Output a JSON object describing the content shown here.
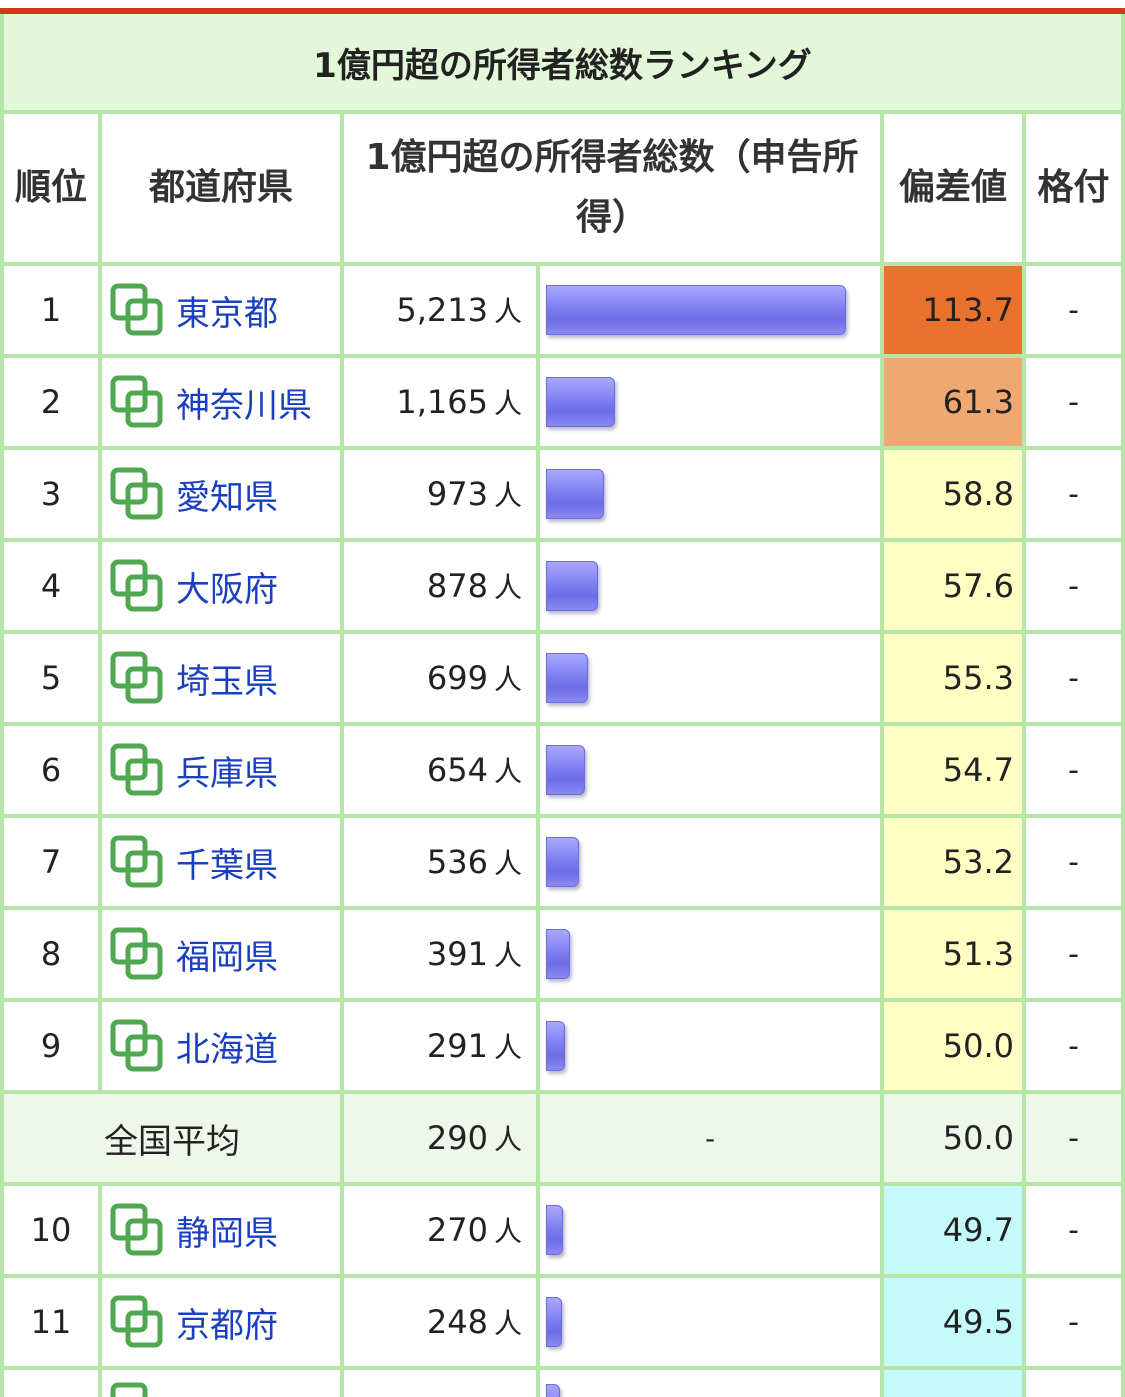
{
  "title": "1億円超の所得者総数ランキング",
  "headers": {
    "rank": "順位",
    "prefecture": "都道府県",
    "total": "1億円超の所得者総数（申告所得）",
    "deviation": "偏差値",
    "grade": "格付"
  },
  "unit": "人",
  "rows": [
    {
      "rank": "1",
      "name": "東京都",
      "value": "5,213",
      "count": 5213,
      "dev": "113.7",
      "grade": "-",
      "color": "#e8722e"
    },
    {
      "rank": "2",
      "name": "神奈川県",
      "value": "1,165",
      "count": 1165,
      "dev": "61.3",
      "grade": "-",
      "color": "#efa872"
    },
    {
      "rank": "3",
      "name": "愛知県",
      "value": "973",
      "count": 973,
      "dev": "58.8",
      "grade": "-",
      "color": "#ffffc4"
    },
    {
      "rank": "4",
      "name": "大阪府",
      "value": "878",
      "count": 878,
      "dev": "57.6",
      "grade": "-",
      "color": "#ffffc4"
    },
    {
      "rank": "5",
      "name": "埼玉県",
      "value": "699",
      "count": 699,
      "dev": "55.3",
      "grade": "-",
      "color": "#ffffc4"
    },
    {
      "rank": "6",
      "name": "兵庫県",
      "value": "654",
      "count": 654,
      "dev": "54.7",
      "grade": "-",
      "color": "#ffffc4"
    },
    {
      "rank": "7",
      "name": "千葉県",
      "value": "536",
      "count": 536,
      "dev": "53.2",
      "grade": "-",
      "color": "#ffffc4"
    },
    {
      "rank": "8",
      "name": "福岡県",
      "value": "391",
      "count": 391,
      "dev": "51.3",
      "grade": "-",
      "color": "#ffffc4"
    },
    {
      "rank": "9",
      "name": "北海道",
      "value": "291",
      "count": 291,
      "dev": "50.0",
      "grade": "-",
      "color": "#ffffc4"
    },
    {
      "avg": true,
      "label": "全国平均",
      "value": "290",
      "count": 290,
      "bar": "-",
      "dev": "50.0",
      "grade": "-",
      "color": "#eef8ea"
    },
    {
      "rank": "10",
      "name": "静岡県",
      "value": "270",
      "count": 270,
      "dev": "49.7",
      "grade": "-",
      "color": "#c4fafa"
    },
    {
      "rank": "11",
      "name": "京都府",
      "value": "248",
      "count": 248,
      "dev": "49.5",
      "grade": "-",
      "color": "#c4fafa"
    }
  ],
  "max_count": 5213,
  "icon": "compare-squares-icon"
}
